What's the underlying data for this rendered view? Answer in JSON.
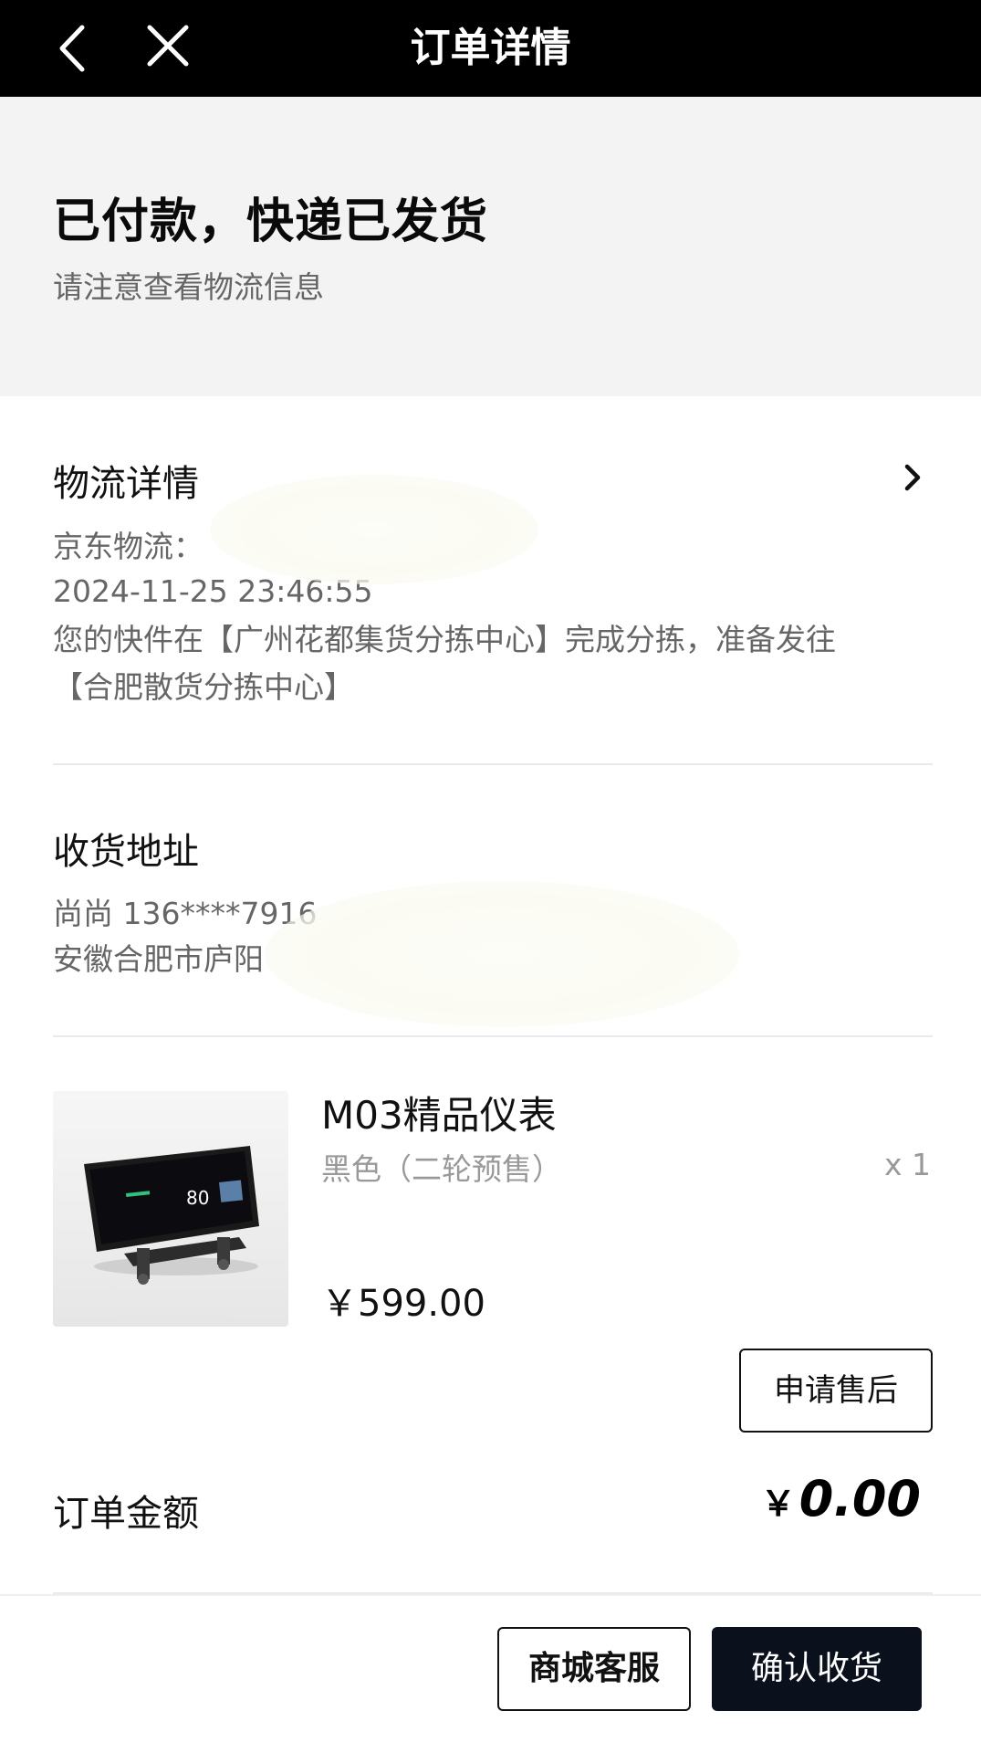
{
  "nav": {
    "title": "订单详情",
    "back_icon": "chevron-left-icon",
    "close_icon": "close-icon"
  },
  "status": {
    "title": "已付款，快递已发货",
    "subtitle": "请注意查看物流信息"
  },
  "logistics": {
    "heading": "物流详情",
    "carrier": "京东物流：",
    "datetime": "2024-11-25 23:46:55",
    "message_line1": "您的快件在【广州花都集货分拣中心】完成分拣，准备发往",
    "message_line2": "【合肥散货分拣中心】"
  },
  "address": {
    "heading": "收货地址",
    "recipient": "尚尚  136****7916",
    "location": "安徽合肥市庐阳"
  },
  "product": {
    "name": "M03精品仪表",
    "spec": "黑色（二轮预售）",
    "quantity": "x 1",
    "price": "￥599.00",
    "screen_speed": "80",
    "after_sale_label": "申请售后"
  },
  "order": {
    "amount_label": "订单金额",
    "amount_currency": "￥",
    "amount_value": "0.00"
  },
  "footer": {
    "service_label": "商城客服",
    "confirm_label": "确认收货"
  },
  "colors": {
    "navbar": "#000000",
    "status_bg": "#f3f3f3",
    "primary_button": "#0b111c",
    "secondary_text": "#666666"
  }
}
